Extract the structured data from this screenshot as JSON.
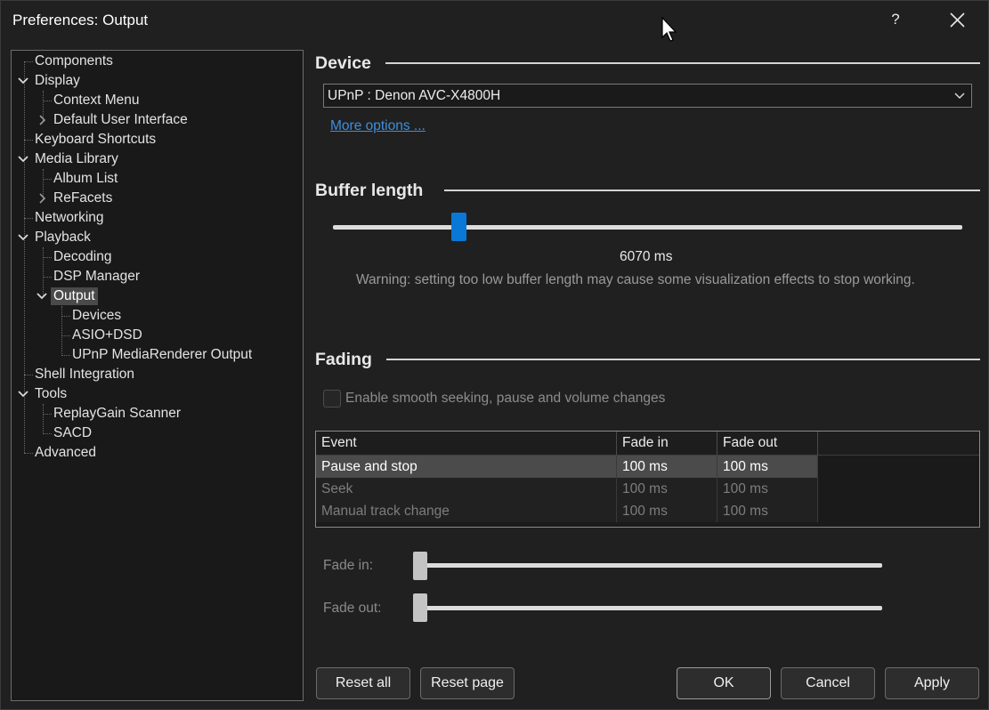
{
  "window": {
    "title": "Preferences: Output",
    "help_glyph": "?"
  },
  "tree": [
    {
      "label": "Components"
    },
    {
      "label": "Display"
    },
    {
      "label": "Context Menu"
    },
    {
      "label": "Default User Interface"
    },
    {
      "label": "Keyboard Shortcuts"
    },
    {
      "label": "Media Library"
    },
    {
      "label": "Album List"
    },
    {
      "label": "ReFacets"
    },
    {
      "label": "Networking"
    },
    {
      "label": "Playback"
    },
    {
      "label": "Decoding"
    },
    {
      "label": "DSP Manager"
    },
    {
      "label": "Output"
    },
    {
      "label": "Devices"
    },
    {
      "label": "ASIO+DSD"
    },
    {
      "label": "UPnP MediaRenderer Output"
    },
    {
      "label": "Shell Integration"
    },
    {
      "label": "Tools"
    },
    {
      "label": "ReplayGain Scanner"
    },
    {
      "label": "SACD"
    },
    {
      "label": "Advanced"
    }
  ],
  "device": {
    "heading": "Device",
    "selected": "UPnP : Denon AVC-X4800H",
    "more_options": "More options ..."
  },
  "buffer": {
    "heading": "Buffer length",
    "value_label": "6070 ms",
    "slider_fraction": 0.2,
    "warning": "Warning: setting too low buffer length may cause some visualization effects to stop working."
  },
  "fading": {
    "heading": "Fading",
    "enable_label": "Enable smooth seeking, pause and volume changes",
    "enable_checked": false,
    "columns": [
      "Event",
      "Fade in",
      "Fade out"
    ],
    "rows": [
      {
        "event": "Pause and stop",
        "fade_in": "100 ms",
        "fade_out": "100 ms"
      },
      {
        "event": "Seek",
        "fade_in": "100 ms",
        "fade_out": "100 ms"
      },
      {
        "event": "Manual track change",
        "fade_in": "100 ms",
        "fade_out": "100 ms"
      }
    ],
    "fade_in_label": "Fade in:",
    "fade_out_label": "Fade out:"
  },
  "buttons": {
    "reset_all": "Reset all",
    "reset_page": "Reset page",
    "ok": "OK",
    "cancel": "Cancel",
    "apply": "Apply"
  },
  "colors": {
    "accent": "#0a78d7",
    "link": "#3b8fe0",
    "background": "#202020"
  }
}
